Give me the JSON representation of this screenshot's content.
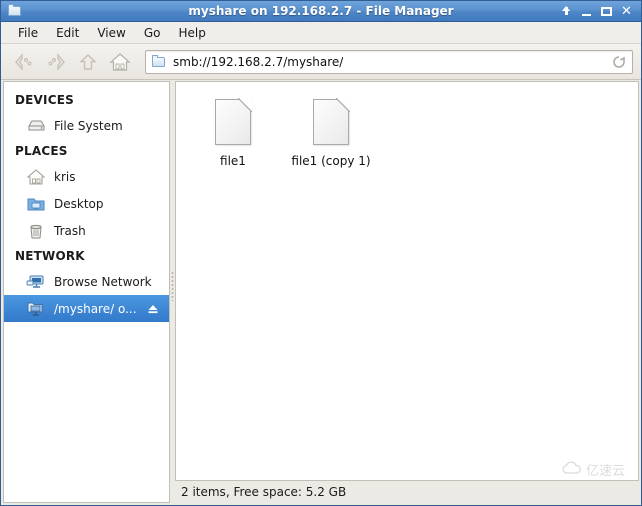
{
  "window": {
    "title": "myshare on 192.168.2.7 - File Manager",
    "icon": "folder-icon",
    "controls": [
      {
        "name": "shade-button",
        "label": "↑"
      },
      {
        "name": "minimize-button",
        "label": "–"
      },
      {
        "name": "maximize-button",
        "label": "□"
      },
      {
        "name": "close-button",
        "label": "✕"
      }
    ]
  },
  "menubar": {
    "items": [
      {
        "label": "File"
      },
      {
        "label": "Edit"
      },
      {
        "label": "View"
      },
      {
        "label": "Go"
      },
      {
        "label": "Help"
      }
    ]
  },
  "toolbar": {
    "buttons": [
      {
        "name": "back-button",
        "icon": "arrow-left-icon",
        "enabled": false
      },
      {
        "name": "forward-button",
        "icon": "arrow-right-icon",
        "enabled": false
      },
      {
        "name": "up-button",
        "icon": "arrow-up-icon",
        "enabled": false
      },
      {
        "name": "home-button",
        "icon": "home-icon",
        "enabled": true
      }
    ],
    "path": {
      "icon": "folder-icon",
      "value": "smb://192.168.2.7/myshare/"
    },
    "reload": {
      "icon": "reload-icon"
    }
  },
  "sidebar": {
    "sections": [
      {
        "header": "DEVICES",
        "items": [
          {
            "label": "File System",
            "icon": "hard-drive-icon",
            "selected": false
          }
        ]
      },
      {
        "header": "PLACES",
        "items": [
          {
            "label": "kris",
            "icon": "home-icon",
            "selected": false
          },
          {
            "label": "Desktop",
            "icon": "desktop-folder-icon",
            "selected": false
          },
          {
            "label": "Trash",
            "icon": "trash-icon",
            "selected": false
          }
        ]
      },
      {
        "header": "NETWORK",
        "items": [
          {
            "label": "Browse Network",
            "icon": "network-icon",
            "selected": false
          },
          {
            "label": "/myshare/ o...",
            "icon": "network-share-icon",
            "selected": true,
            "eject": true
          }
        ]
      }
    ]
  },
  "files": {
    "items": [
      {
        "name": "file1",
        "icon": "document-icon"
      },
      {
        "name": "file1 (copy 1)",
        "icon": "document-icon"
      }
    ]
  },
  "statusbar": {
    "text": "2 items, Free space: 5.2 GB"
  },
  "watermark": {
    "text": "亿速云",
    "icon": "cloud-icon"
  },
  "colors": {
    "titlebar_start": "#6fa3da",
    "titlebar_end": "#417ac0",
    "titlebar_border": "#2f5d94",
    "selection": "#3279ca",
    "chrome": "#eceae5",
    "pane_background": "#ffffff"
  }
}
